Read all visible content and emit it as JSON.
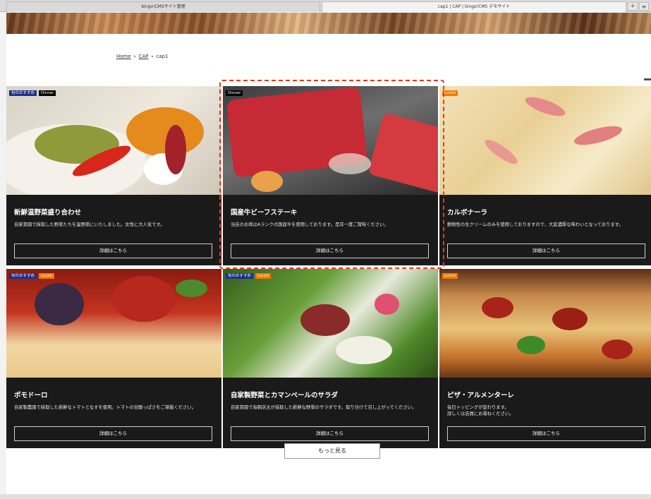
{
  "browser": {
    "tabs": [
      {
        "label": "bingo!CMSサイト管理"
      },
      {
        "label": "cap1 | CAP | bingo!CMS デモサイト"
      }
    ],
    "add_tab": "+",
    "more": "≡"
  },
  "breadcrumb": {
    "home": "Home",
    "cap": "CAP",
    "current": "cap1",
    "separator": "›"
  },
  "cards": [
    {
      "title": "新鮮温野菜盛り合わせ",
      "desc": "自家菜園で採取した野菜たちを温野菜にいたしました。女性に大人気です。",
      "button": "詳細はこちら",
      "badges": [
        "旬のおすすめ",
        "Dinner"
      ]
    },
    {
      "title": "国産牛ビーフステーキ",
      "desc": "当店のお肉はAランクの国産牛を使用しております。是非一度ご賞味ください。",
      "button": "詳細はこちら",
      "badges": [
        "Dinner"
      ]
    },
    {
      "title": "カルボナーラ",
      "desc": "動物性の生クリームのみを使用しておりますので、大変濃厚な味わいとなっております。",
      "button": "詳細はこちら",
      "badges": [
        "Lunch"
      ]
    },
    {
      "title": "ポモドーロ",
      "desc": "自家製農園で採取した新鮮なトマトとなすを使用。トマトの甘酸っぱさをご堪能ください。",
      "button": "詳細はこちら",
      "badges": [
        "旬のおすすめ",
        "Lunch"
      ]
    },
    {
      "title": "自家製野菜とカマンベールのサラダ",
      "desc": "自家菜園で毎朝店主が採取した新鮮な野菜のサラダです。取り分けて召し上がってください。",
      "button": "詳細はこちら",
      "badges": [
        "旬のおすすめ",
        "Lunch"
      ]
    },
    {
      "title": "ピザ・アルメンターレ",
      "desc": "毎日トッピングが変わります。\n詳しくは店員にお尋ねください。",
      "button": "詳細はこちら",
      "badges": [
        "Lunch"
      ]
    }
  ],
  "more_button": "もっと見る",
  "colors": {
    "card_bg": "#1a1a1a",
    "badge_season": "#1f2f8a",
    "badge_dinner": "#000000",
    "badge_lunch": "#f07a00",
    "highlight": "#e23b1b"
  }
}
